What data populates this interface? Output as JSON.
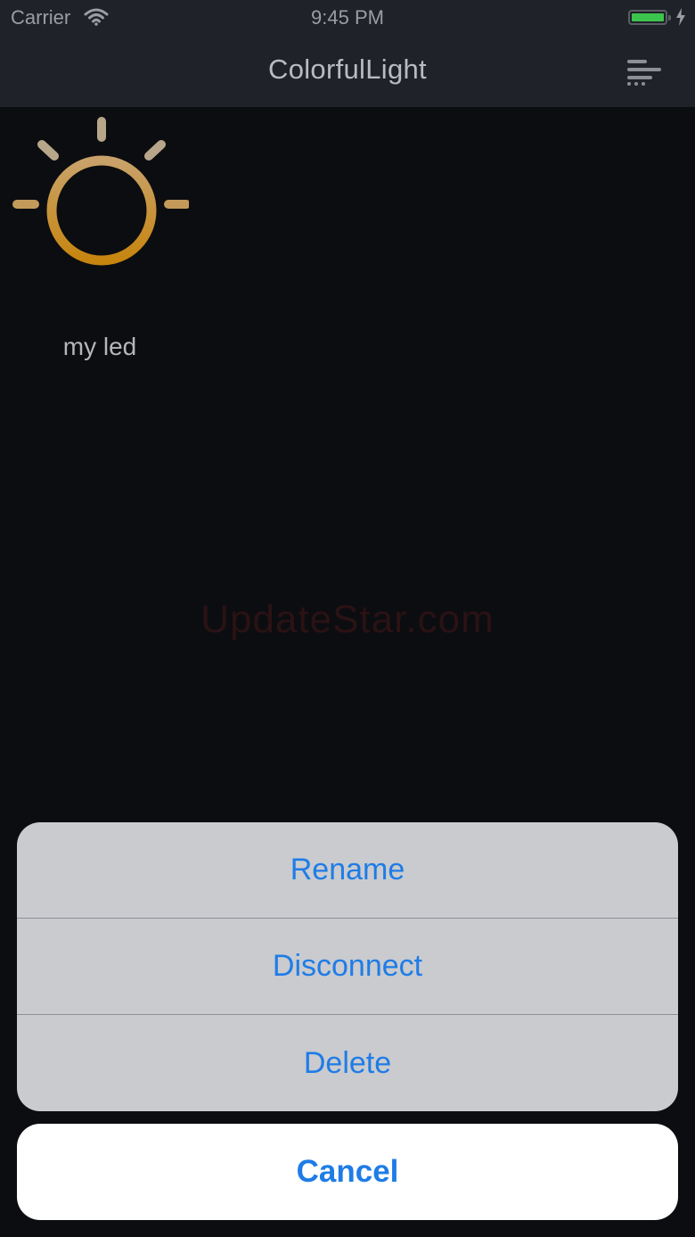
{
  "status_bar": {
    "carrier": "Carrier",
    "time": "9:45 PM",
    "battery_color": "#3cc54d"
  },
  "nav": {
    "title": "ColorfulLight",
    "menu_icon": "menu-list-icon"
  },
  "device": {
    "name": "my led",
    "icon": "light-bulb-icon",
    "icon_color": "#c98a1b"
  },
  "watermark": "UpdateStar.com",
  "action_sheet": {
    "actions": [
      {
        "label": "Rename"
      },
      {
        "label": "Disconnect"
      },
      {
        "label": "Delete"
      }
    ],
    "cancel_label": "Cancel",
    "accent_color": "#1f7ce6"
  }
}
